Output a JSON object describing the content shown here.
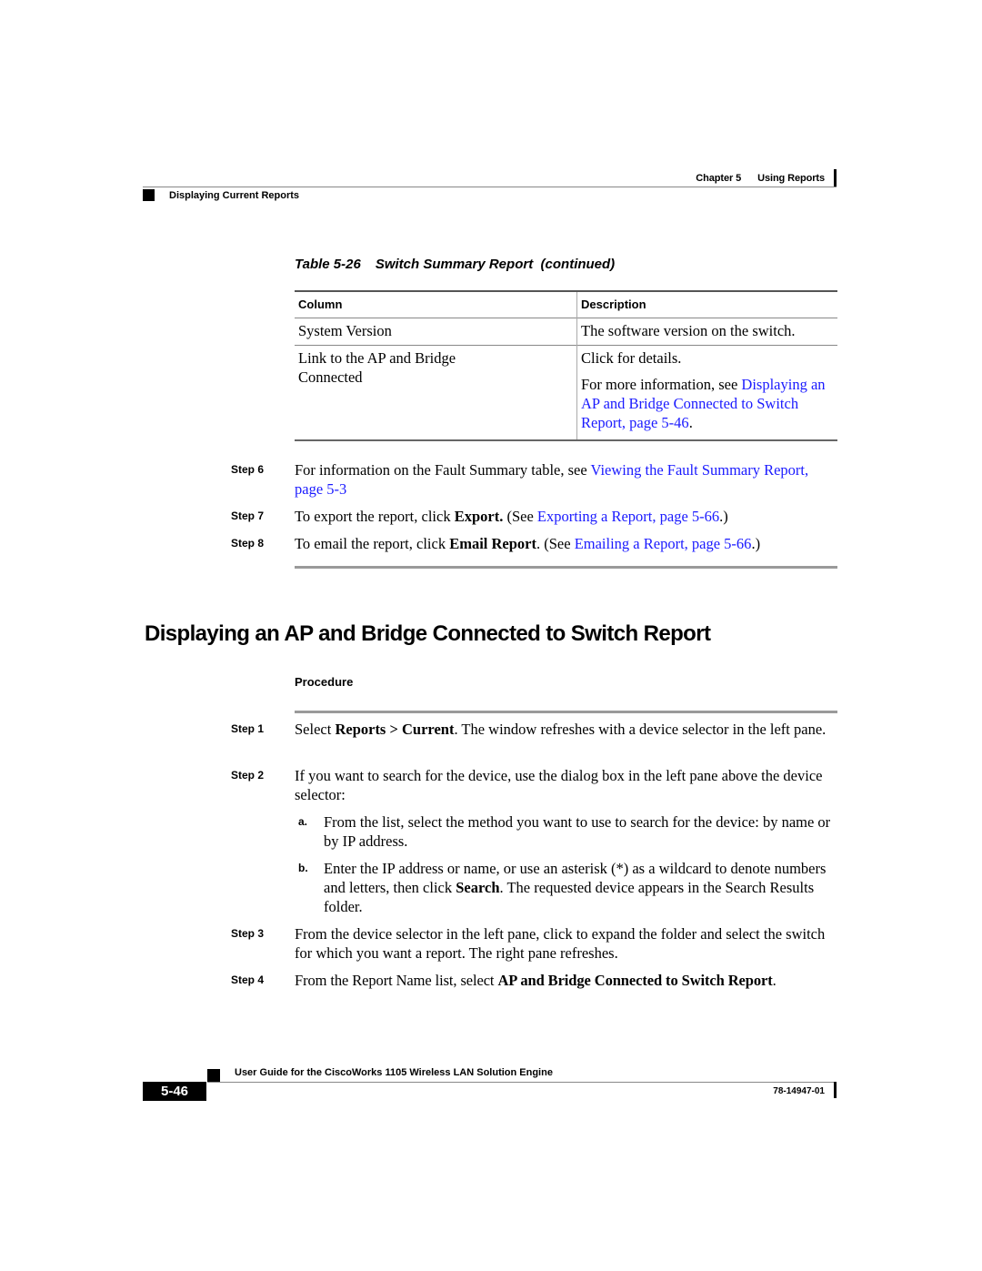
{
  "header": {
    "chapter": "Chapter 5",
    "chapter_title": "Using Reports",
    "section": "Displaying Current Reports"
  },
  "table": {
    "caption_number": "Table 5-26",
    "caption_title": "Switch Summary Report",
    "caption_suffix": "(continued)",
    "columns": [
      "Column",
      "Description"
    ],
    "rows": [
      {
        "column": "System Version",
        "description": "The software version on the switch."
      },
      {
        "column": "Link to the AP and Bridge Connected",
        "description": "Click for details.",
        "more_prefix": "For more information, see ",
        "more_link": "Displaying an AP and Bridge Connected to Switch Report, page 5-46",
        "more_suffix": "."
      }
    ]
  },
  "steps_continued": [
    {
      "label": "Step 6",
      "prefix": "For information on the Fault Summary table, see ",
      "link": "Viewing the Fault Summary Report, page 5-3",
      "suffix": ""
    },
    {
      "label": "Step 7",
      "prefix": "To export the report, click ",
      "bold": "Export.",
      "middle": " (See ",
      "link": "Exporting a Report, page 5-66",
      "suffix": ".)"
    },
    {
      "label": "Step 8",
      "prefix": "To email the report, click ",
      "bold": "Email Report",
      "middle": ". (See ",
      "link": "Emailing a Report, page 5-66",
      "suffix": ".)"
    }
  ],
  "section": {
    "title": "Displaying an AP and Bridge Connected to Switch Report",
    "procedure_label": "Procedure",
    "steps": [
      {
        "label": "Step 1",
        "prefix": "Select ",
        "bold": "Reports > Current",
        "suffix": ". The window refreshes with a device selector in the left pane."
      },
      {
        "label": "Step 2",
        "text": "If you want to search for the device, use the dialog box in the left pane above the device selector:",
        "substeps": [
          {
            "label": "a.",
            "text": "From the list, select the method you want to use to search for the device: by name or by IP address."
          },
          {
            "label": "b.",
            "prefix": "Enter the IP address or name, or use an asterisk (*) as a wildcard to denote numbers and letters, then click ",
            "bold": "Search",
            "suffix": ". The requested device appears in the Search Results folder."
          }
        ]
      },
      {
        "label": "Step 3",
        "text": "From the device selector in the left pane, click to expand the folder and select the switch for which you want a report. The right pane refreshes."
      },
      {
        "label": "Step 4",
        "prefix": "From the Report Name list, select ",
        "bold": "AP and Bridge Connected to Switch Report",
        "suffix": "."
      }
    ]
  },
  "footer": {
    "guide_title": "User Guide for the CiscoWorks 1105 Wireless LAN Solution Engine",
    "page_number": "5-46",
    "doc_number": "78-14947-01"
  },
  "colors": {
    "link": "#1a1aff",
    "text": "#000000",
    "rule": "#9a9a9a"
  }
}
